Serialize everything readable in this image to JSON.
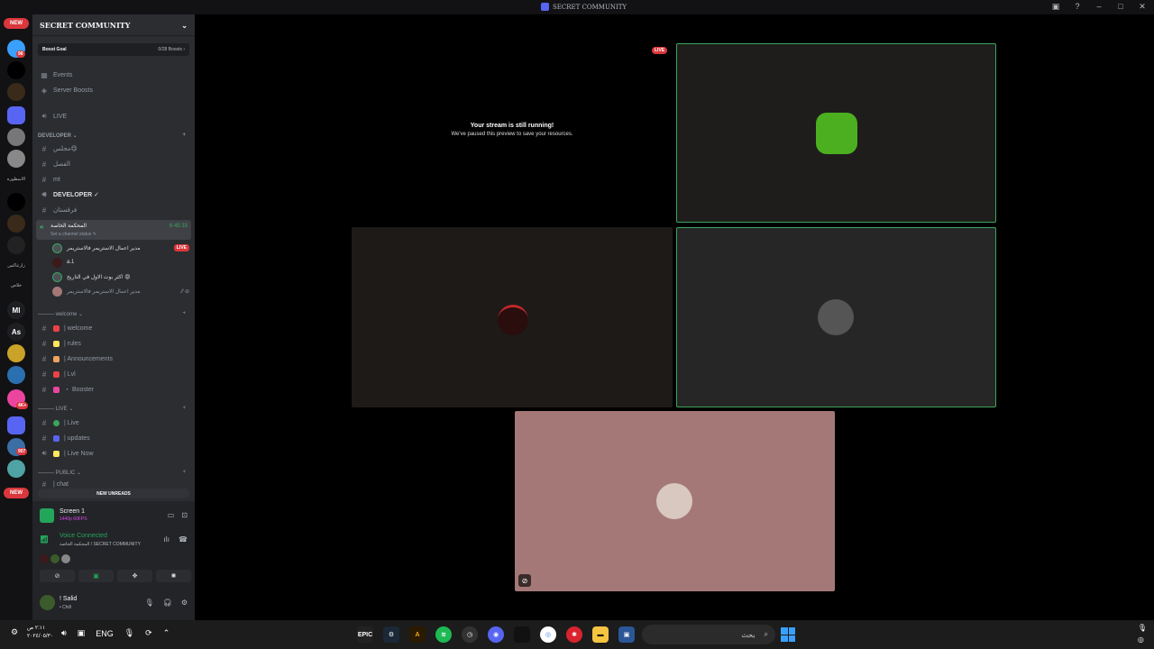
{
  "window": {
    "title": "SECRET COMMUNITY"
  },
  "sidebar": {
    "server_name": "SECRET COMMUNITY",
    "boost_goal": {
      "label": "Boost Goal",
      "value": "0/28 Boosts ›"
    },
    "top_items": [
      {
        "label": "Events",
        "icon": "calendar-icon"
      },
      {
        "label": "Server Boosts",
        "icon": "boost-icon"
      },
      {
        "label": "LIVE",
        "icon": "speaker-icon"
      }
    ],
    "developer_category": "DEVELOPER ⌄",
    "developer_channels": [
      {
        "label": "مجلس😋",
        "icon": "hash-icon"
      },
      {
        "label": "الفصل",
        "icon": "hash-icon"
      },
      {
        "label": "mt",
        "icon": "hash-icon"
      },
      {
        "label": "DEVELOPER ✓",
        "icon": "speaker-icon"
      },
      {
        "label": "فرقستان",
        "icon": "hash-icon"
      }
    ],
    "active_voice": {
      "name": "المحكمة الخاصة",
      "status": "Set a channel status ✎",
      "timer": "6:45:33"
    },
    "voice_users": [
      {
        "name": "مدير اعمال الاستريمر فالاستريمر",
        "live": "LIVE"
      },
      {
        "name": "a.1"
      },
      {
        "name": "اكثر بوت الاول في التاريخ 😡"
      },
      {
        "name": "مدير اعمال الاستريمر فالاستريمر"
      }
    ],
    "welcome_category": "——— welcome ⌄",
    "welcome_channels": [
      {
        "label": "| welcome",
        "emoji_color": "#ed4245"
      },
      {
        "label": "| rules",
        "emoji_color": "#fee75c"
      },
      {
        "label": "| Announcements",
        "emoji_color": "#f0a35e"
      },
      {
        "label": "| Lvl",
        "emoji_color": "#ed4245"
      },
      {
        "label": "・ Booster",
        "emoji_color": "#eb459e"
      }
    ],
    "live_category": "——— LIVE ⌄",
    "live_channels": [
      {
        "label": "| Live",
        "icon": "hash-icon",
        "emoji_color": "#3ba55d"
      },
      {
        "label": "| updates",
        "icon": "hash-icon",
        "emoji_color": "#5865f2"
      },
      {
        "label": "| Live Now",
        "icon": "speaker-icon",
        "emoji_color": "#fee75c"
      }
    ],
    "public_category": "——— PUBLIC ⌄",
    "public_channels": [
      {
        "label": "| chat",
        "icon": "hash-icon"
      }
    ],
    "new_unreads": "NEW UNREADS"
  },
  "rail": {
    "new_pill": "NEW",
    "badges": [
      "98",
      "907",
      "4K+"
    ],
    "text_labels": [
      "الاسطوره",
      "زارعاكس",
      "خلاص"
    ],
    "letter_icons": [
      "Ml",
      "As"
    ]
  },
  "panel": {
    "screen_title": "Screen 1",
    "screen_subtitle": "1440p 60FPS",
    "voice_connected": "Voice Connected",
    "voice_path": "المحكمة الخاصة / SECRET COMMUNITY",
    "username": "! Salid",
    "user_status": "• Chill"
  },
  "stage": {
    "paused_title": "Your stream is still running!",
    "paused_body": "We've paused this preview to save your resources.",
    "live_tag": "LIVE",
    "tile_colors": {
      "tile1": "#1e1d1b",
      "tile2": "#1d1a17",
      "tile3": "#262626",
      "tile4": "#a57878"
    }
  },
  "taskbar": {
    "lang": "ENG",
    "search_placeholder": "بحث",
    "time": "٢:١١ ص",
    "date": "٢٠٢٤/٠٥/٣٠"
  },
  "colors": {
    "accent_green": "#23a55a",
    "danger_red": "#da373c",
    "blurple": "#5865f2"
  }
}
